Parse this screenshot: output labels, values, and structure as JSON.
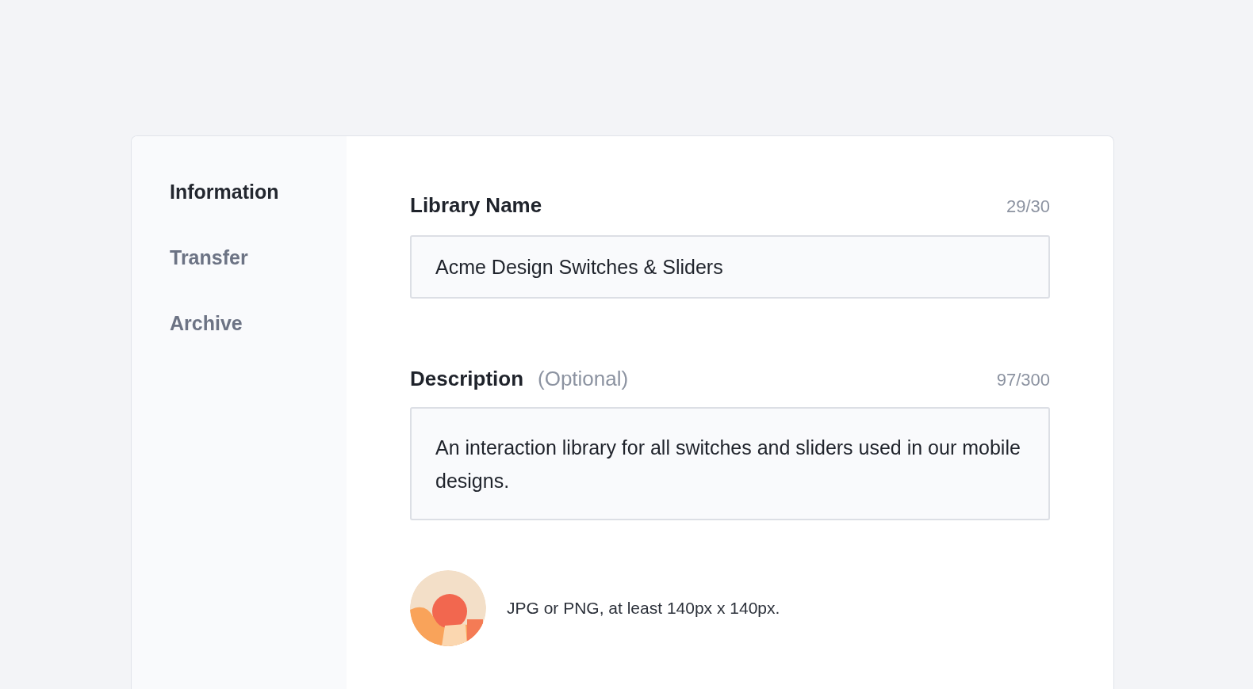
{
  "sidebar": {
    "items": [
      {
        "label": "Information",
        "selected": true
      },
      {
        "label": "Transfer",
        "selected": false
      },
      {
        "label": "Archive",
        "selected": false
      }
    ]
  },
  "form": {
    "library_name": {
      "label": "Library Name",
      "counter": "29/30",
      "value": "Acme Design Switches & Sliders"
    },
    "description": {
      "label": "Description",
      "optional": "(Optional)",
      "counter": "97/300",
      "value": "An interaction library for all switches and sliders used in our mobile designs."
    },
    "image": {
      "hint": "JPG or PNG, at least 140px x 140px."
    }
  }
}
